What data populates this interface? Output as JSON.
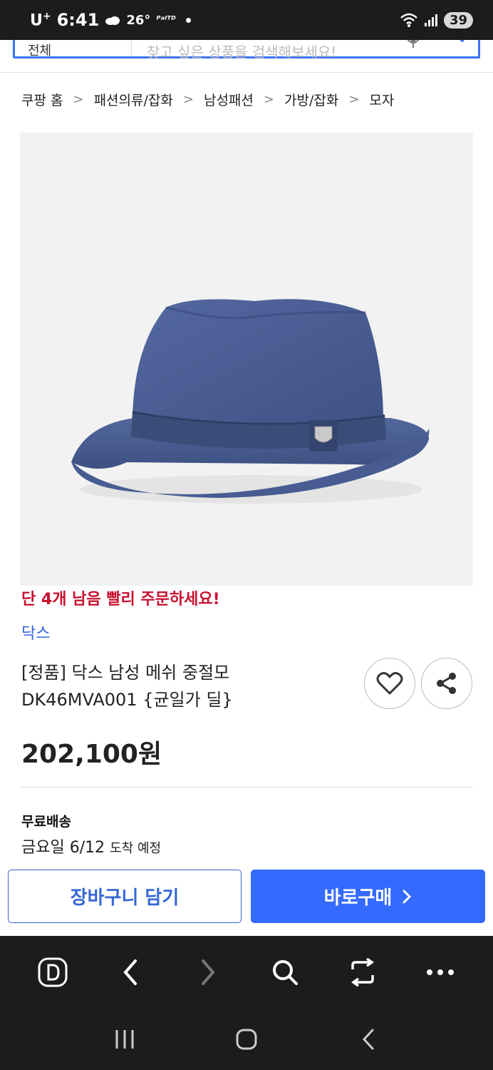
{
  "status_bar": {
    "carrier": "U",
    "carrier_sup": "+",
    "time": "6:41",
    "temperature": "26°",
    "app_glyph": "ᴾᵃᴵᵀᴰ",
    "battery": "39"
  },
  "search": {
    "category_label": "전체",
    "placeholder": "찾고 싶은 상품을 검색해보세요!"
  },
  "breadcrumb": [
    "쿠팡 홈",
    "패션의류/잡화",
    "남성패션",
    "가방/잡화",
    "모자"
  ],
  "product": {
    "stock_alert": "단 4개 남음 빨리 주문하세요!",
    "brand": "닥스",
    "title": "[정품] 닥스 남성 메쉬 중절모 DK46MVA001 {균일가 딜}",
    "price": "202,100원",
    "colors": {
      "hat_main": "#4a5f8e",
      "hat_band": "#3a4c78",
      "accent_red": "#c8102e",
      "link_blue": "#3466d6",
      "cta_blue": "#346aff"
    }
  },
  "shipping": {
    "title": "무료배송",
    "arrival_date": "금요일 6/12",
    "arrival_suffix": "도착 예정"
  },
  "actions": {
    "cart_label": "장바구니 담기",
    "buy_label": "바로구매"
  },
  "toolbar_icons": [
    "d-logo-icon",
    "back-arrow-icon",
    "forward-arrow-icon",
    "search-icon",
    "tabs-switch-icon",
    "more-icon"
  ],
  "nav_icons": [
    "recent-apps-icon",
    "home-icon",
    "back-icon"
  ]
}
